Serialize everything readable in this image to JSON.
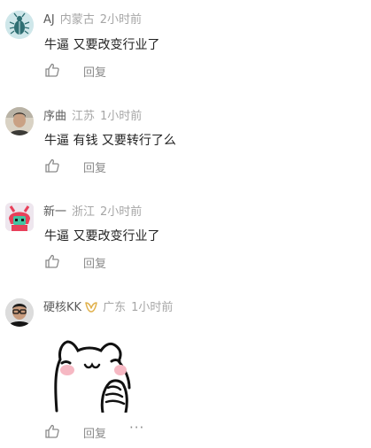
{
  "comments": [
    {
      "nickname": "AJ",
      "location": "内蒙古",
      "time": "2小时前",
      "text": "牛逼 又要改变行业了",
      "reply_label": "回复",
      "avatar": "beetle-avatar"
    },
    {
      "nickname": "序曲",
      "location": "江苏",
      "time": "1小时前",
      "text": "牛逼 有钱 又要转行了么",
      "reply_label": "回复",
      "avatar": "man-photo-avatar"
    },
    {
      "nickname": "新一",
      "location": "浙江",
      "time": "2小时前",
      "text": "牛逼 又要改变行业了",
      "reply_label": "回复",
      "avatar": "pixel-character-avatar"
    },
    {
      "nickname": "硬核KK",
      "location": "广东",
      "time": "1小时前",
      "reply_label": "回复",
      "more_label": "···",
      "avatar": "man-glasses-avatar",
      "badge": "gold-badge-icon",
      "sticker": "cartoon-cat-sticker"
    }
  ],
  "colors": {
    "nickname": "#5a5a5a",
    "meta": "#a6a6a6",
    "action": "#8a8a8a",
    "badge": "#e0b04a"
  }
}
